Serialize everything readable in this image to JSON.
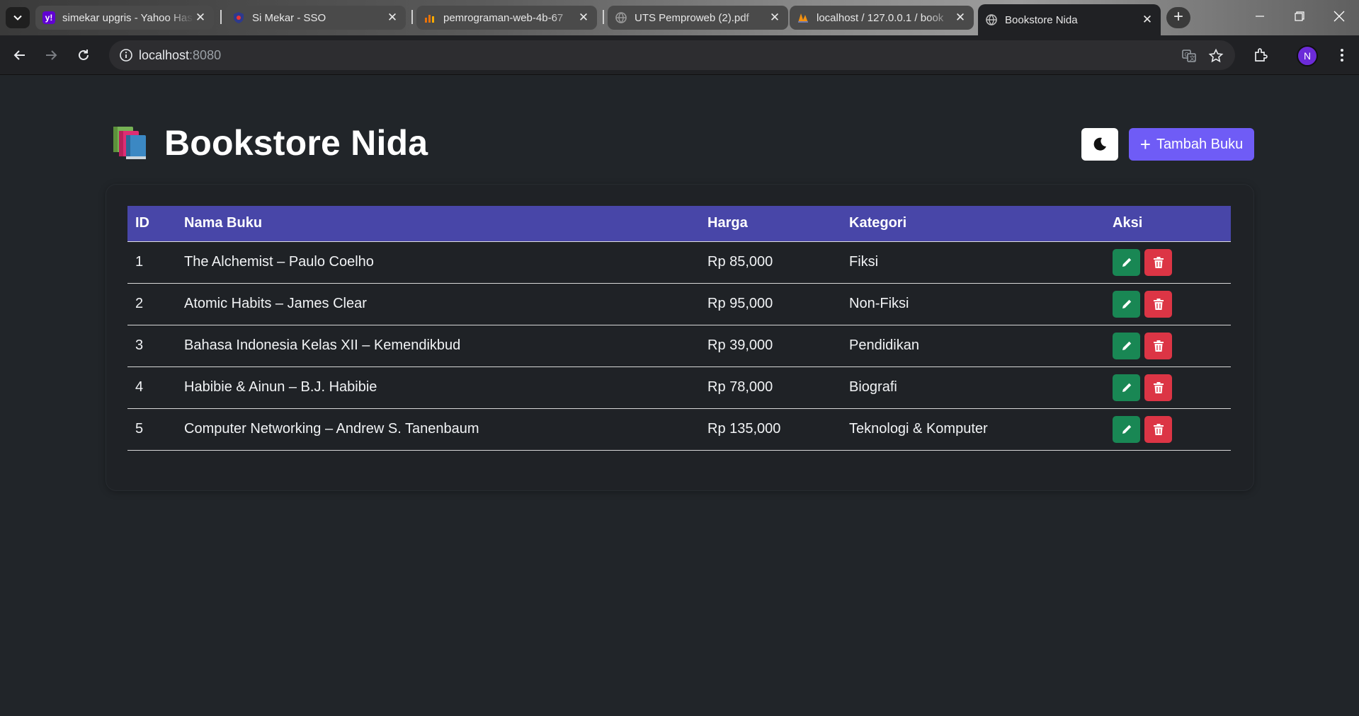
{
  "browser": {
    "tabs": [
      {
        "title": "simekar upgris - Yahoo Has",
        "favicon": "yahoo-icon",
        "color": "#6001d2"
      },
      {
        "title": "Si Mekar - SSO",
        "favicon": "shield-icon",
        "color": "#3a3a7a"
      },
      {
        "title": "pemrograman-web-4b-67",
        "favicon": "chart-icon",
        "color": "#e8710a"
      },
      {
        "title": "UTS Pemproweb (2).pdf",
        "favicon": "globe-icon",
        "color": "#8a8a8a"
      },
      {
        "title": "localhost / 127.0.0.1 / book",
        "favicon": "phpmyadmin-icon",
        "color": "#f29111"
      },
      {
        "title": "Bookstore Nida",
        "favicon": "globe-icon",
        "color": "#bdbdbd"
      }
    ],
    "url_host": "localhost",
    "url_port": ":8080",
    "profile_initial": "N"
  },
  "app": {
    "title": "Bookstore Nida",
    "add_button_label": "Tambah Buku",
    "colors": {
      "primary": "#6f5cf6",
      "table_header": "#4846a8",
      "edit": "#198754",
      "delete": "#dc3545",
      "background": "#212529"
    }
  },
  "table": {
    "headers": {
      "id": "ID",
      "name": "Nama Buku",
      "price": "Harga",
      "category": "Kategori",
      "actions": "Aksi"
    },
    "rows": [
      {
        "id": "1",
        "name": "The Alchemist – Paulo Coelho",
        "price": "Rp 85,000",
        "category": "Fiksi"
      },
      {
        "id": "2",
        "name": "Atomic Habits – James Clear",
        "price": "Rp 95,000",
        "category": "Non-Fiksi"
      },
      {
        "id": "3",
        "name": "Bahasa Indonesia Kelas XII – Kemendikbud",
        "price": "Rp 39,000",
        "category": "Pendidikan"
      },
      {
        "id": "4",
        "name": "Habibie & Ainun – B.J. Habibie",
        "price": "Rp 78,000",
        "category": "Biografi"
      },
      {
        "id": "5",
        "name": "Computer Networking – Andrew S. Tanenbaum",
        "price": "Rp 135,000",
        "category": "Teknologi & Komputer"
      }
    ]
  }
}
